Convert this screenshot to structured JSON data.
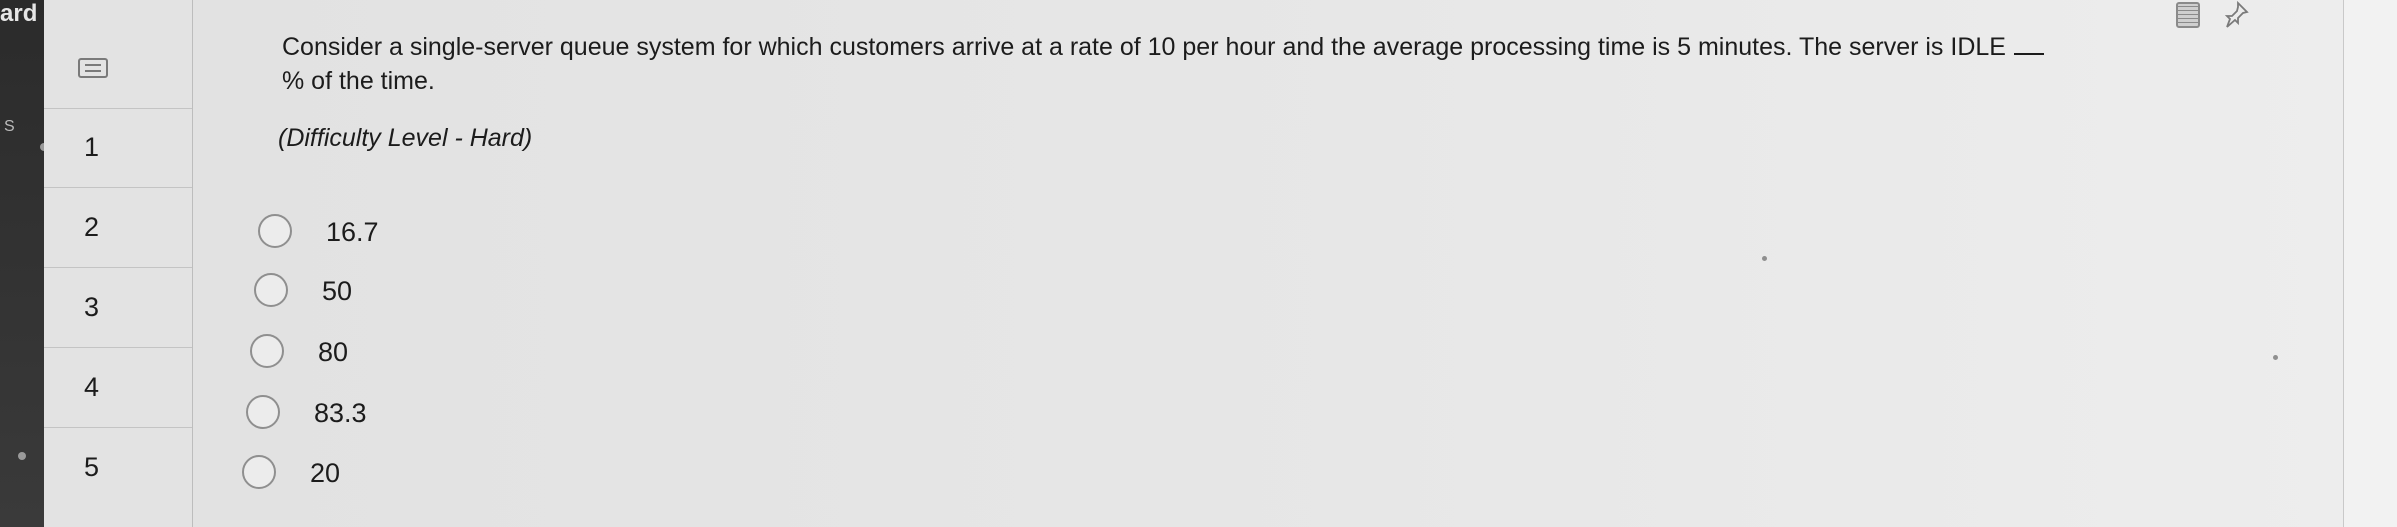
{
  "left_panel": {
    "label": "ard",
    "side_letter": "S"
  },
  "nav": {
    "items": [
      {
        "label": "1"
      },
      {
        "label": "2"
      },
      {
        "label": "3"
      },
      {
        "label": "4"
      },
      {
        "label": "5"
      }
    ]
  },
  "question": {
    "line1": "Consider a single-server queue system for which customers arrive at a rate of 10 per hour and the average processing time is 5 minutes. The server is IDLE",
    "line2": "% of the time.",
    "difficulty": "(Difficulty Level - Hard)"
  },
  "options": [
    {
      "label": "16.7"
    },
    {
      "label": "50"
    },
    {
      "label": "80"
    },
    {
      "label": "83.3"
    },
    {
      "label": "20"
    }
  ],
  "toolbar": {
    "calculator_icon": "calculator-icon",
    "pin_icon": "pin-icon"
  }
}
